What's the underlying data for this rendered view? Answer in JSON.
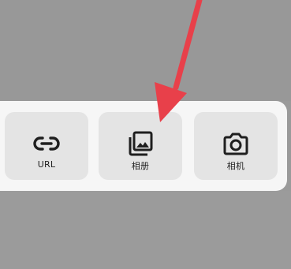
{
  "sheet": {
    "options": [
      {
        "label": "URL",
        "icon": "link-icon"
      },
      {
        "label": "相册",
        "icon": "album-icon"
      },
      {
        "label": "相机",
        "icon": "camera-icon"
      }
    ]
  },
  "annotation": {
    "arrow_color": "#e8404a"
  },
  "colors": {
    "overlay": "#9a9a9a",
    "sheet_bg": "#f6f6f6",
    "option_bg": "#e4e4e4",
    "icon": "#1f1f1f"
  }
}
